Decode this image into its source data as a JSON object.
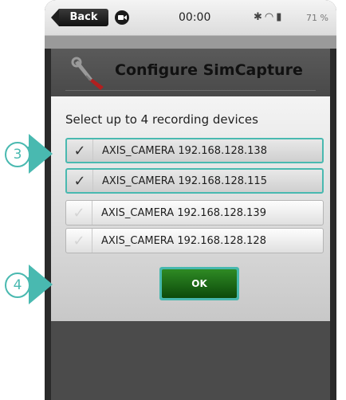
{
  "statusbar": {
    "back_label": "Back",
    "camera_icon": "video-camera-icon",
    "time": "00:00",
    "icons": [
      "bluetooth-icon",
      "wifi-icon",
      "battery-icon"
    ],
    "battery_percent": "71 %"
  },
  "dialog": {
    "title": "Configure SimCapture",
    "icon": "wrench-screwdriver-icon",
    "prompt": "Select up to 4 recording devices",
    "devices": [
      {
        "label": "AXIS_CAMERA 192.168.128.138",
        "checked": true
      },
      {
        "label": "AXIS_CAMERA 192.168.128.115",
        "checked": true
      },
      {
        "label": "AXIS_CAMERA 192.168.128.139",
        "checked": false
      },
      {
        "label": "AXIS_CAMERA 192.168.128.128",
        "checked": false
      }
    ],
    "ok_label": "OK"
  },
  "callouts": [
    {
      "number": "3"
    },
    {
      "number": "4"
    }
  ],
  "colors": {
    "accent": "#49b9b0",
    "ok_button": "#1f6b1a",
    "header": "#4f4f4f"
  }
}
